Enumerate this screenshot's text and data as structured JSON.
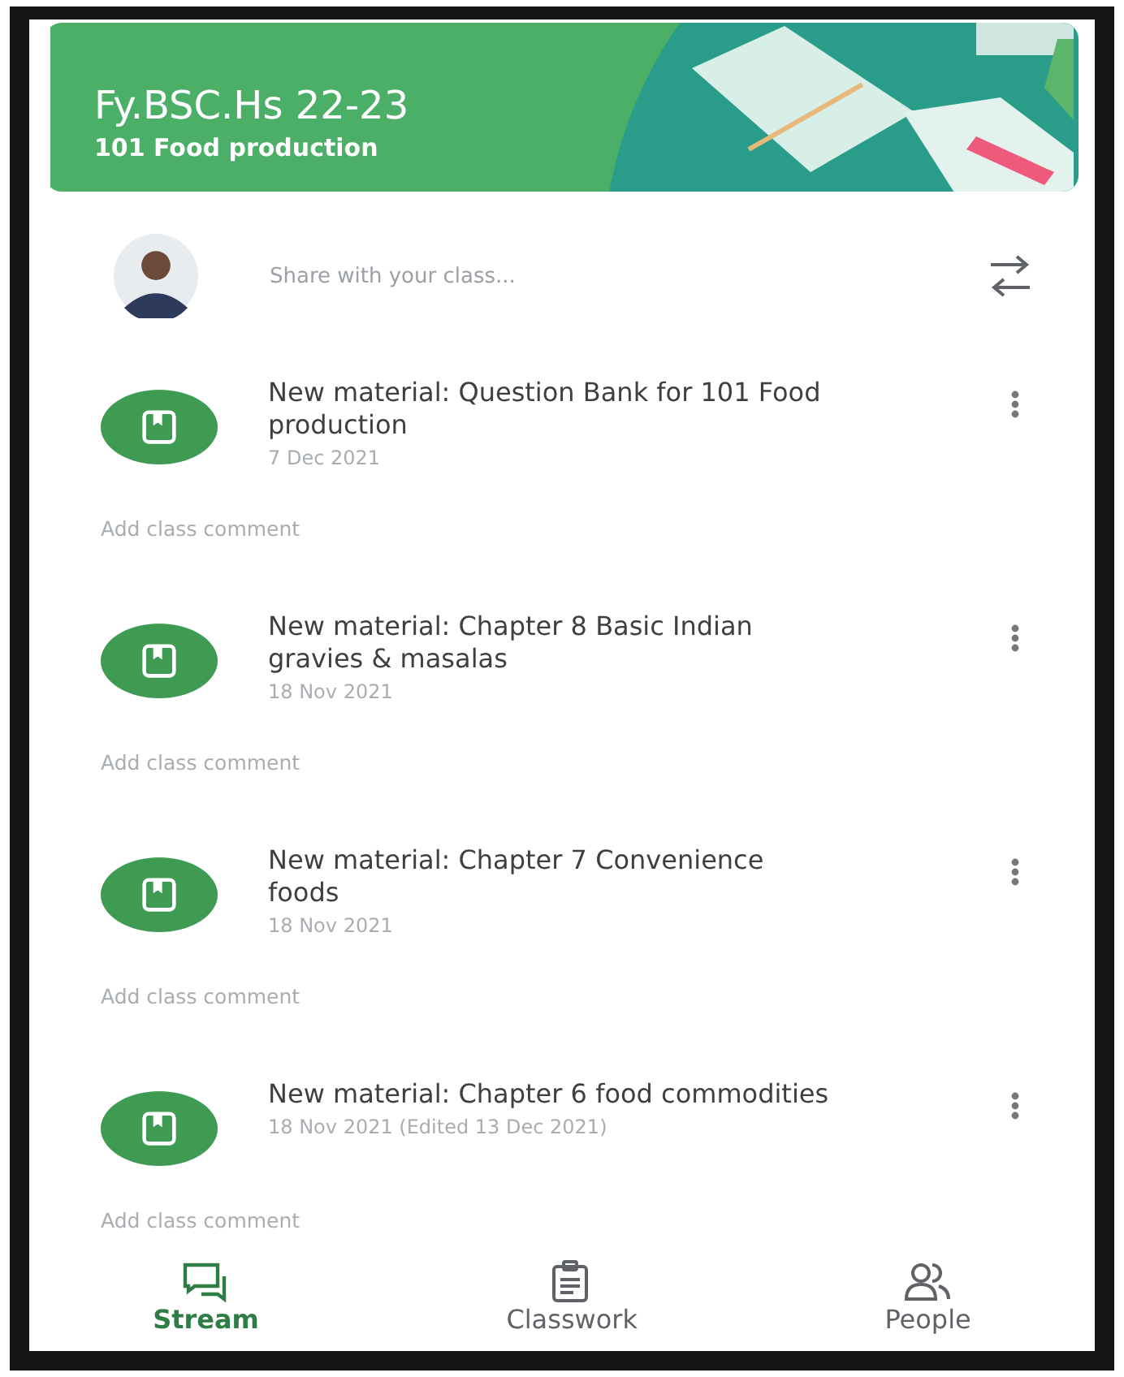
{
  "class_banner": {
    "title": "Fy.BSC.Hs 22-23",
    "subtitle": "101 Food production"
  },
  "share": {
    "placeholder": "Share with your class..."
  },
  "stream_items": [
    {
      "title": "New material: Question Bank for 101 Food production",
      "date": "7 Dec 2021",
      "comment_placeholder": "Add class comment"
    },
    {
      "title": "New material: Chapter 8 Basic Indian gravies & masalas",
      "date": "18 Nov 2021",
      "comment_placeholder": "Add class comment"
    },
    {
      "title": "New material: Chapter  7 Convenience foods",
      "date": "18 Nov 2021",
      "comment_placeholder": "Add class comment"
    },
    {
      "title": "New material: Chapter  6 food commodities",
      "date": "18 Nov 2021 (Edited 13 Dec 2021)",
      "comment_placeholder": "Add class comment"
    }
  ],
  "bottom_nav": [
    {
      "label": "Stream",
      "kind": "stream",
      "selected": true
    },
    {
      "label": "Classwork",
      "kind": "classwork",
      "selected": false
    },
    {
      "label": "People",
      "kind": "people",
      "selected": false
    }
  ]
}
